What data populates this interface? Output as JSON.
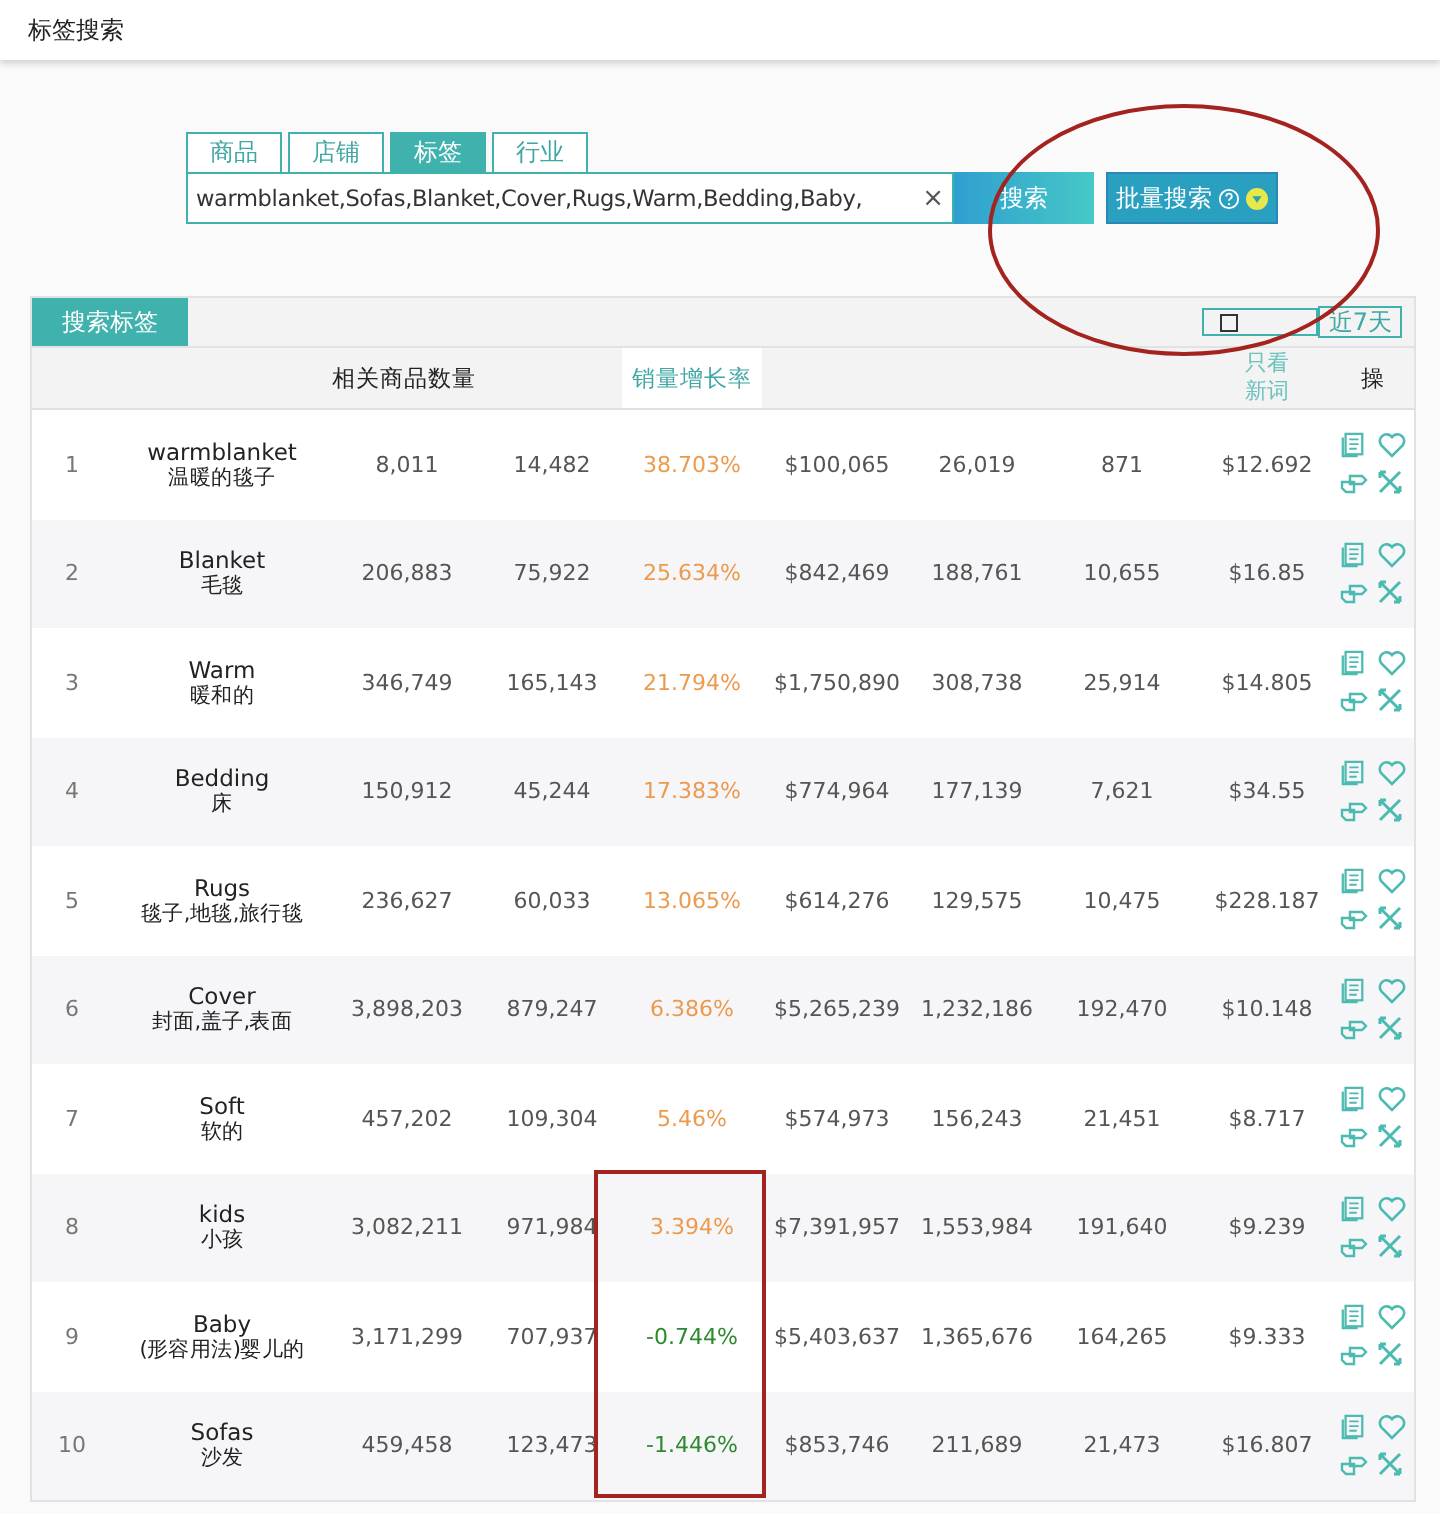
{
  "page_title": "标签搜索",
  "search_tabs": [
    {
      "label": "商品",
      "selected": false
    },
    {
      "label": "店铺",
      "selected": false
    },
    {
      "label": "标签",
      "selected": true
    },
    {
      "label": "行业",
      "selected": false
    }
  ],
  "search": {
    "value": "warmblanket,Sofas,Blanket,Cover,Rugs,Warm,Bedding,Baby,",
    "clear": "×",
    "button": "搜索",
    "batch_button": "批量搜索"
  },
  "panel": {
    "tab": "搜索标签",
    "period": "近7天"
  },
  "columns": {
    "related_count": "相关商品数量",
    "growth": "销量增长率",
    "new_words": "只看新词",
    "ops": "操"
  },
  "rows": [
    {
      "index": "1",
      "keyword": "warmblanket",
      "translation": "温暖的毯子",
      "column_3": "8,011",
      "column_4": "14,482",
      "growth": "38.703%",
      "color": "#ec9a4e",
      "column_6": "$100,065",
      "column_7": "26,019",
      "column_8": "871",
      "column_9": "$12.692"
    },
    {
      "index": "2",
      "keyword": "Blanket",
      "translation": "毛毯",
      "column_3": "206,883",
      "column_4": "75,922",
      "growth": "25.634%",
      "color": "#ec9a4e",
      "column_6": "$842,469",
      "column_7": "188,761",
      "column_8": "10,655",
      "column_9": "$16.85"
    },
    {
      "index": "3",
      "keyword": "Warm",
      "translation": "暖和的",
      "column_3": "346,749",
      "column_4": "165,143",
      "growth": "21.794%",
      "color": "#ec9a4e",
      "column_6": "$1,750,890",
      "column_7": "308,738",
      "column_8": "25,914",
      "column_9": "$14.805"
    },
    {
      "index": "4",
      "keyword": "Bedding",
      "translation": "床",
      "column_3": "150,912",
      "column_4": "45,244",
      "growth": "17.383%",
      "color": "#ec9a4e",
      "column_6": "$774,964",
      "column_7": "177,139",
      "column_8": "7,621",
      "column_9": "$34.55"
    },
    {
      "index": "5",
      "keyword": "Rugs",
      "translation": "毯子,地毯,旅行毯",
      "column_3": "236,627",
      "column_4": "60,033",
      "growth": "13.065%",
      "color": "#ec9a4e",
      "column_6": "$614,276",
      "column_7": "129,575",
      "column_8": "10,475",
      "column_9": "$228.187"
    },
    {
      "index": "6",
      "keyword": "Cover",
      "translation": "封面,盖子,表面",
      "column_3": "3,898,203",
      "column_4": "879,247",
      "growth": "6.386%",
      "color": "#ec9a4e",
      "column_6": "$5,265,239",
      "column_7": "1,232,186",
      "column_8": "192,470",
      "column_9": "$10.148"
    },
    {
      "index": "7",
      "keyword": "Soft",
      "translation": "软的",
      "column_3": "457,202",
      "column_4": "109,304",
      "growth": "5.46%",
      "color": "#ec9a4e",
      "column_6": "$574,973",
      "column_7": "156,243",
      "column_8": "21,451",
      "column_9": "$8.717"
    },
    {
      "index": "8",
      "keyword": "kids",
      "translation": "小孩",
      "column_3": "3,082,211",
      "column_4": "971,984",
      "growth": "3.394%",
      "color": "#ec9a4e",
      "column_6": "$7,391,957",
      "column_7": "1,553,984",
      "column_8": "191,640",
      "column_9": "$9.239"
    },
    {
      "index": "9",
      "keyword": "Baby",
      "translation": "(形容用法)婴儿的",
      "column_3": "3,171,299",
      "column_4": "707,937",
      "growth": "-0.744%",
      "color": "#2e8a30",
      "column_6": "$5,403,637",
      "column_7": "1,365,676",
      "column_8": "164,265",
      "column_9": "$9.333"
    },
    {
      "index": "10",
      "keyword": "Sofas",
      "translation": "沙发",
      "column_3": "459,458",
      "column_4": "123,473",
      "growth": "-1.446%",
      "color": "#2e8a30",
      "column_6": "$853,746",
      "column_7": "211,689",
      "column_8": "21,473",
      "column_9": "$16.807"
    }
  ]
}
